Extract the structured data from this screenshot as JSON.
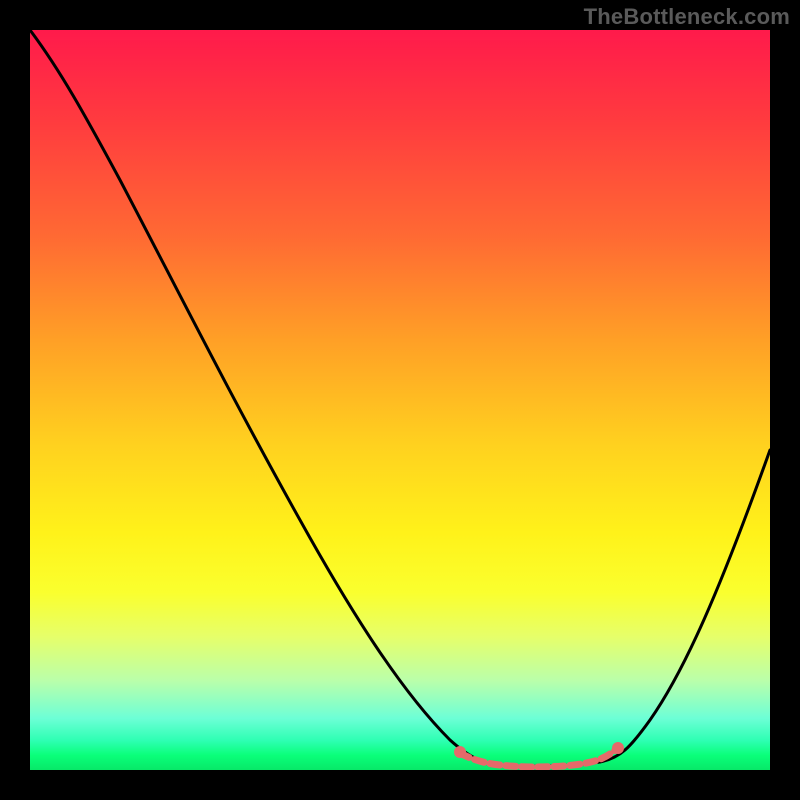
{
  "watermark": "TheBottleneck.com",
  "chart_data": {
    "type": "line",
    "title": "",
    "xlabel": "",
    "ylabel": "",
    "xlim": [
      0,
      100
    ],
    "ylim": [
      0,
      100
    ],
    "series": [
      {
        "name": "bottleneck-curve",
        "x": [
          0,
          5,
          10,
          15,
          20,
          25,
          30,
          35,
          40,
          45,
          50,
          55,
          58,
          60,
          62,
          65,
          70,
          72,
          75,
          78,
          80,
          83,
          85,
          88,
          90,
          93,
          96,
          100
        ],
        "y": [
          100,
          97,
          92,
          86,
          79,
          71,
          63,
          55,
          47,
          39,
          31,
          23,
          18,
          14,
          11,
          7,
          3,
          2,
          1,
          1,
          2,
          5,
          9,
          15,
          22,
          30,
          40,
          50
        ]
      }
    ],
    "highlight": {
      "name": "optimal-range",
      "x_start": 60,
      "x_end": 80,
      "y": 2
    },
    "colors": {
      "gradient_top": "#ff1a4b",
      "gradient_mid": "#ffe11a",
      "gradient_bottom": "#07e868",
      "curve": "#000000",
      "highlight": "#e56a6a"
    }
  }
}
